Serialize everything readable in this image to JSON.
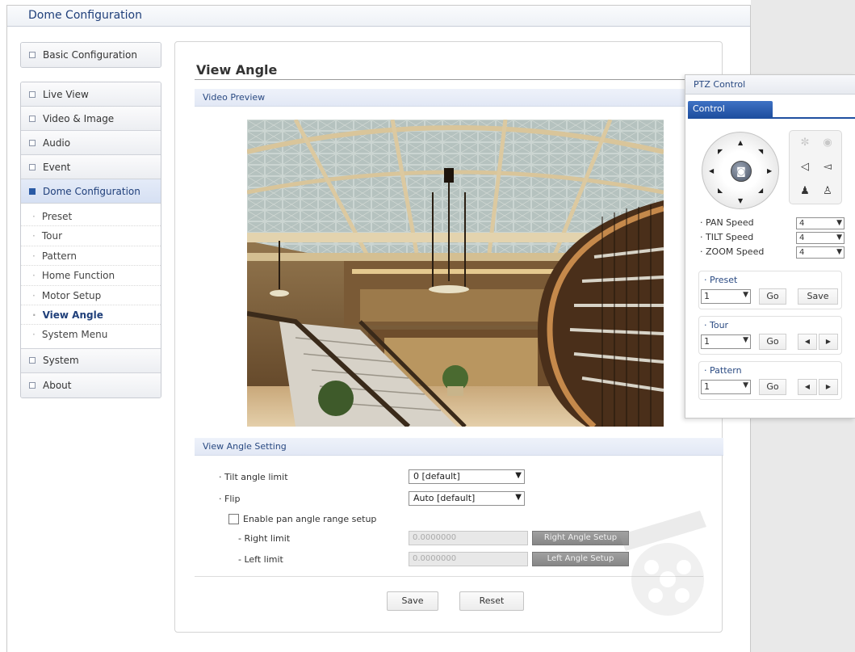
{
  "header": {
    "title": "Dome Configuration"
  },
  "sidebar": {
    "basic": "Basic Configuration",
    "items": [
      "Live View",
      "Video & Image",
      "Audio",
      "Event"
    ],
    "active": "Dome Configuration",
    "sub_items": [
      "Preset",
      "Tour",
      "Pattern",
      "Home Function",
      "Motor Setup",
      "View Angle",
      "System Menu"
    ],
    "after": [
      "System",
      "About"
    ]
  },
  "main": {
    "title": "View Angle",
    "preview_section": "Video Preview",
    "setting_section": "View Angle Setting",
    "tilt_label": "Tilt angle limit",
    "tilt_value": "0   [default]",
    "flip_label": "Flip",
    "flip_value": "Auto  [default]",
    "enable_pan_label": "Enable pan angle range setup",
    "right_limit_label": "- Right limit",
    "right_limit_value": "0.0000000",
    "right_btn": "Right Angle Setup",
    "left_limit_label": "- Left limit",
    "left_limit_value": "0.0000000",
    "left_btn": "Left Angle Setup",
    "save": "Save",
    "reset": "Reset"
  },
  "ptz": {
    "title": "PTZ Control",
    "tab": "Control",
    "pan_label": "PAN Speed",
    "pan_value": "4",
    "tilt_label": "TILT Speed",
    "tilt_value": "4",
    "zoom_label": "ZOOM Speed",
    "zoom_value": "4",
    "preset_label": "Preset",
    "preset_value": "1",
    "go": "Go",
    "save": "Save",
    "tour_label": "Tour",
    "tour_value": "1",
    "pattern_label": "Pattern",
    "pattern_value": "1"
  },
  "icons": [
    "arrow-up-icon",
    "arrow-down-icon",
    "arrow-left-icon",
    "arrow-right-icon",
    "focus-near-icon",
    "focus-far-icon",
    "zoom-in-icon",
    "zoom-out-icon",
    "iris-open-icon",
    "iris-close-icon"
  ]
}
